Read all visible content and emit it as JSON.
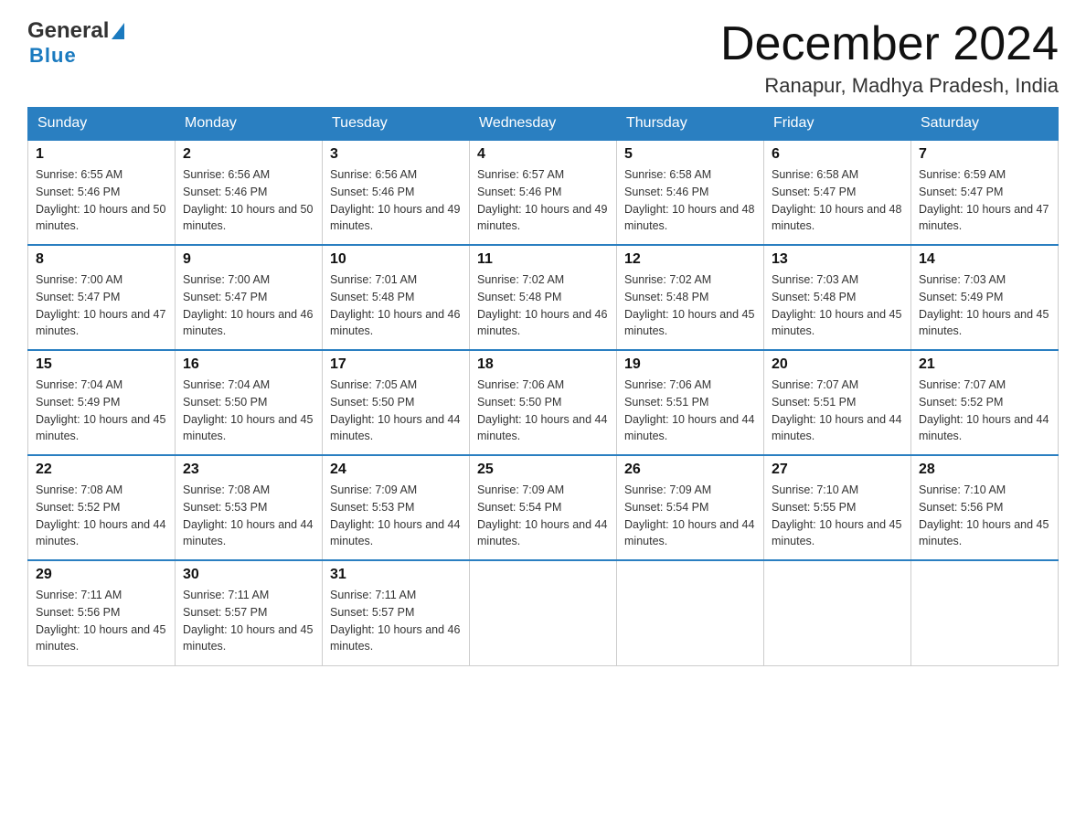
{
  "header": {
    "logo": {
      "general": "General",
      "blue": "Blue"
    },
    "title": "December 2024",
    "location": "Ranapur, Madhya Pradesh, India"
  },
  "weekdays": [
    "Sunday",
    "Monday",
    "Tuesday",
    "Wednesday",
    "Thursday",
    "Friday",
    "Saturday"
  ],
  "weeks": [
    [
      {
        "day": "1",
        "sunrise": "6:55 AM",
        "sunset": "5:46 PM",
        "daylight": "10 hours and 50 minutes."
      },
      {
        "day": "2",
        "sunrise": "6:56 AM",
        "sunset": "5:46 PM",
        "daylight": "10 hours and 50 minutes."
      },
      {
        "day": "3",
        "sunrise": "6:56 AM",
        "sunset": "5:46 PM",
        "daylight": "10 hours and 49 minutes."
      },
      {
        "day": "4",
        "sunrise": "6:57 AM",
        "sunset": "5:46 PM",
        "daylight": "10 hours and 49 minutes."
      },
      {
        "day": "5",
        "sunrise": "6:58 AM",
        "sunset": "5:46 PM",
        "daylight": "10 hours and 48 minutes."
      },
      {
        "day": "6",
        "sunrise": "6:58 AM",
        "sunset": "5:47 PM",
        "daylight": "10 hours and 48 minutes."
      },
      {
        "day": "7",
        "sunrise": "6:59 AM",
        "sunset": "5:47 PM",
        "daylight": "10 hours and 47 minutes."
      }
    ],
    [
      {
        "day": "8",
        "sunrise": "7:00 AM",
        "sunset": "5:47 PM",
        "daylight": "10 hours and 47 minutes."
      },
      {
        "day": "9",
        "sunrise": "7:00 AM",
        "sunset": "5:47 PM",
        "daylight": "10 hours and 46 minutes."
      },
      {
        "day": "10",
        "sunrise": "7:01 AM",
        "sunset": "5:48 PM",
        "daylight": "10 hours and 46 minutes."
      },
      {
        "day": "11",
        "sunrise": "7:02 AM",
        "sunset": "5:48 PM",
        "daylight": "10 hours and 46 minutes."
      },
      {
        "day": "12",
        "sunrise": "7:02 AM",
        "sunset": "5:48 PM",
        "daylight": "10 hours and 45 minutes."
      },
      {
        "day": "13",
        "sunrise": "7:03 AM",
        "sunset": "5:48 PM",
        "daylight": "10 hours and 45 minutes."
      },
      {
        "day": "14",
        "sunrise": "7:03 AM",
        "sunset": "5:49 PM",
        "daylight": "10 hours and 45 minutes."
      }
    ],
    [
      {
        "day": "15",
        "sunrise": "7:04 AM",
        "sunset": "5:49 PM",
        "daylight": "10 hours and 45 minutes."
      },
      {
        "day": "16",
        "sunrise": "7:04 AM",
        "sunset": "5:50 PM",
        "daylight": "10 hours and 45 minutes."
      },
      {
        "day": "17",
        "sunrise": "7:05 AM",
        "sunset": "5:50 PM",
        "daylight": "10 hours and 44 minutes."
      },
      {
        "day": "18",
        "sunrise": "7:06 AM",
        "sunset": "5:50 PM",
        "daylight": "10 hours and 44 minutes."
      },
      {
        "day": "19",
        "sunrise": "7:06 AM",
        "sunset": "5:51 PM",
        "daylight": "10 hours and 44 minutes."
      },
      {
        "day": "20",
        "sunrise": "7:07 AM",
        "sunset": "5:51 PM",
        "daylight": "10 hours and 44 minutes."
      },
      {
        "day": "21",
        "sunrise": "7:07 AM",
        "sunset": "5:52 PM",
        "daylight": "10 hours and 44 minutes."
      }
    ],
    [
      {
        "day": "22",
        "sunrise": "7:08 AM",
        "sunset": "5:52 PM",
        "daylight": "10 hours and 44 minutes."
      },
      {
        "day": "23",
        "sunrise": "7:08 AM",
        "sunset": "5:53 PM",
        "daylight": "10 hours and 44 minutes."
      },
      {
        "day": "24",
        "sunrise": "7:09 AM",
        "sunset": "5:53 PM",
        "daylight": "10 hours and 44 minutes."
      },
      {
        "day": "25",
        "sunrise": "7:09 AM",
        "sunset": "5:54 PM",
        "daylight": "10 hours and 44 minutes."
      },
      {
        "day": "26",
        "sunrise": "7:09 AM",
        "sunset": "5:54 PM",
        "daylight": "10 hours and 44 minutes."
      },
      {
        "day": "27",
        "sunrise": "7:10 AM",
        "sunset": "5:55 PM",
        "daylight": "10 hours and 45 minutes."
      },
      {
        "day": "28",
        "sunrise": "7:10 AM",
        "sunset": "5:56 PM",
        "daylight": "10 hours and 45 minutes."
      }
    ],
    [
      {
        "day": "29",
        "sunrise": "7:11 AM",
        "sunset": "5:56 PM",
        "daylight": "10 hours and 45 minutes."
      },
      {
        "day": "30",
        "sunrise": "7:11 AM",
        "sunset": "5:57 PM",
        "daylight": "10 hours and 45 minutes."
      },
      {
        "day": "31",
        "sunrise": "7:11 AM",
        "sunset": "5:57 PM",
        "daylight": "10 hours and 46 minutes."
      },
      null,
      null,
      null,
      null
    ]
  ]
}
